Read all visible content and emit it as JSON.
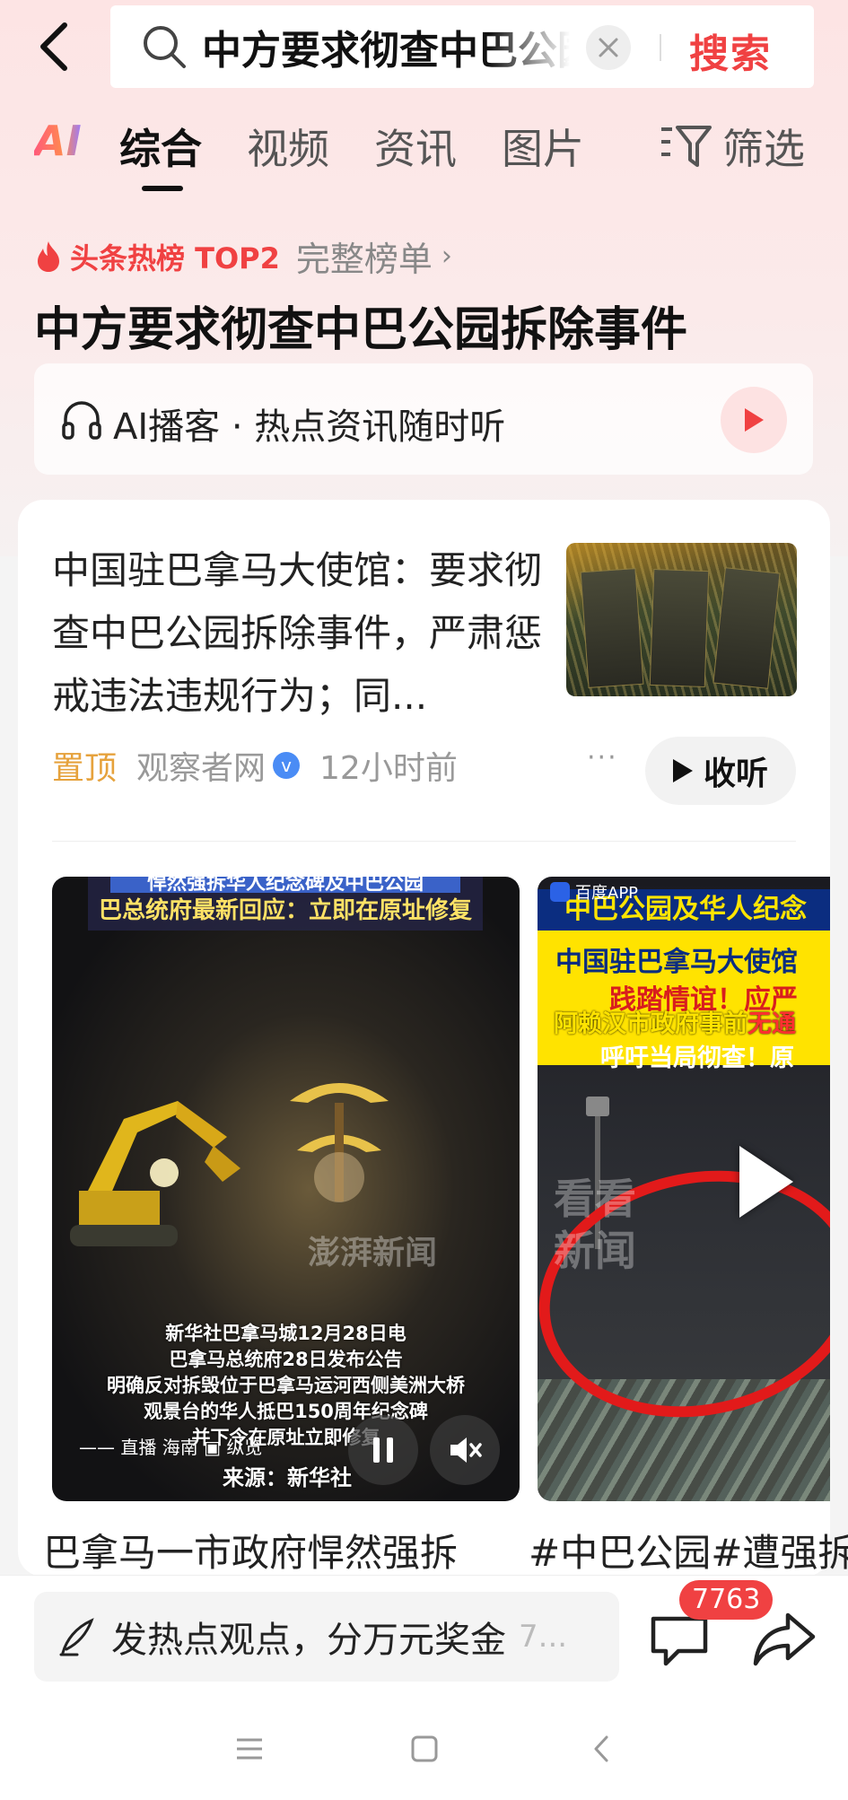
{
  "search": {
    "query": "中方要求彻查中巴公园拆除事件",
    "button_label": "搜索"
  },
  "tabs": [
    {
      "label": "AI"
    },
    {
      "label": "综合",
      "active": true
    },
    {
      "label": "视频"
    },
    {
      "label": "资讯"
    },
    {
      "label": "图片"
    }
  ],
  "filter_label": "筛选",
  "hot": {
    "rank_label": "头条热榜 TOP2",
    "full_list_label": "完整榜单",
    "chevron": "›",
    "headline": "中方要求彻查中巴公园拆除事件"
  },
  "podcast": {
    "text": "AI播客 · 热点资讯随时听"
  },
  "news": {
    "title": "中国驻巴拿马大使馆：要求彻查中巴公园拆除事件，严肃惩戒违法违规行为；同...",
    "pinned_label": "置顶",
    "source": "观察者网",
    "verified_mark": "v",
    "time": "12小时前",
    "more_dots": "···",
    "listen_label": "收听"
  },
  "videos": [
    {
      "banner_top": "悍然强拆华人纪念碑及中巴公园",
      "banner_sub": "巴总统府最新回应：立即在原址修复",
      "watermark": "澎湃新闻",
      "caption_lines": [
        "新华社巴拿马城12月28日电",
        "巴拿马总统府28日发布公告",
        "明确反对拆毁位于巴拿马运河西侧美洲大桥",
        "观景台的华人抵巴150周年纪念碑",
        "并下令在原址立即修复"
      ],
      "ticker": "—— 直播 海南 ▣ 纵览",
      "source_label": "来源：新华社",
      "title": "巴拿马一市政府悍然强拆"
    },
    {
      "app_label": "百度APP",
      "header": "中巴公园及华人纪念",
      "yellow_line1": "中国驻巴拿马大使馆",
      "yellow_line2": "践踏情谊！应严",
      "red_line_pre": "阿赖汉市政府事前",
      "red_line_em": "无通",
      "white_line": "呼吁当局彻查！原",
      "watermark_line1": "看看",
      "watermark_line2": "新闻",
      "title": "#中巴公园#遭强拆"
    }
  ],
  "bottom": {
    "comment_prompt": "发热点观点，分万元奖金",
    "comment_extra": "7...",
    "comment_count": "7763"
  },
  "colors": {
    "accent": "#f04142",
    "pinned": "#e6a23c",
    "verified": "#4a8cf5"
  }
}
